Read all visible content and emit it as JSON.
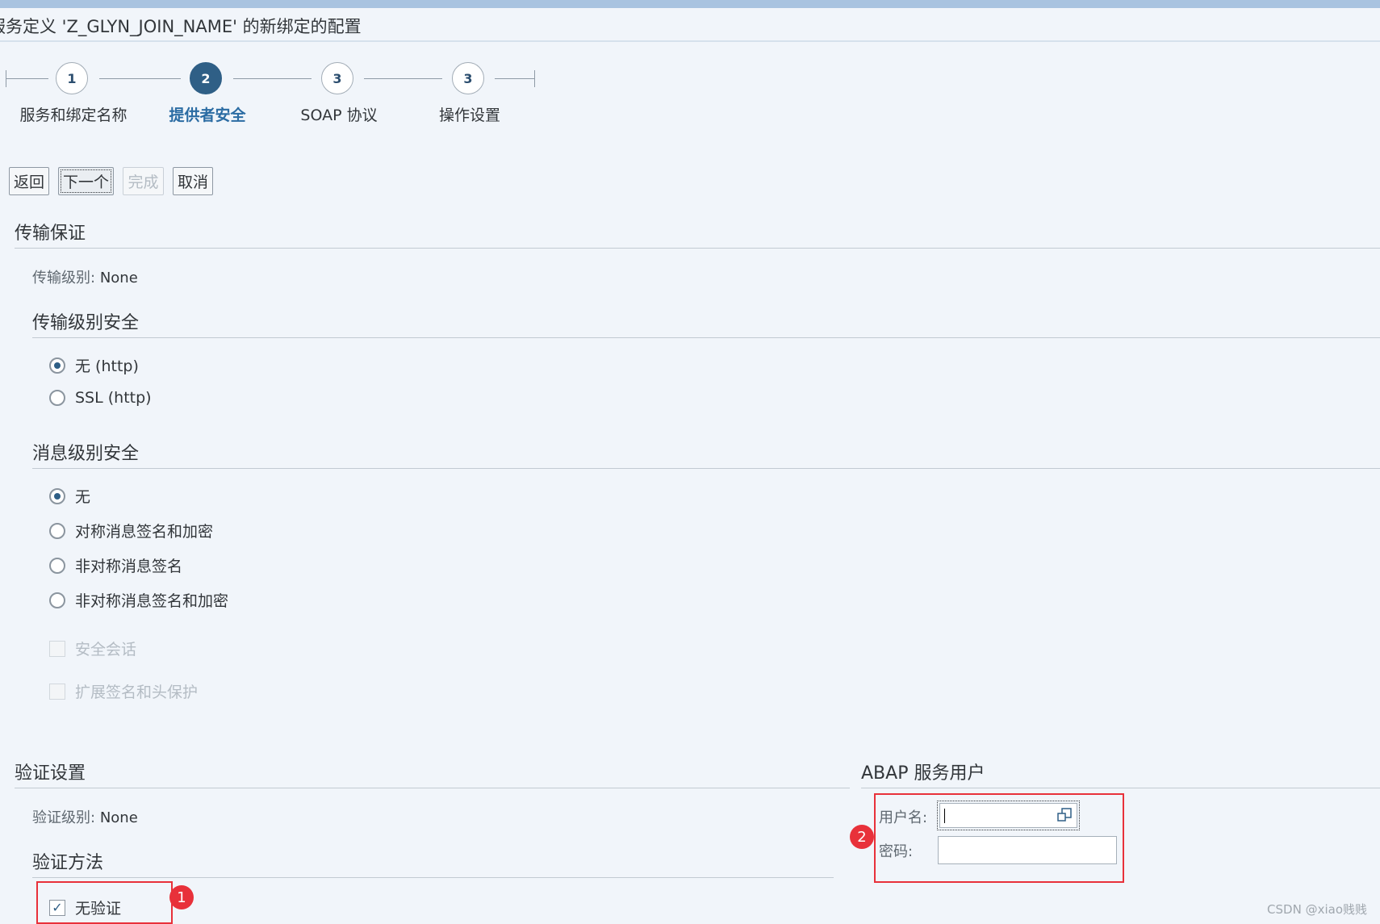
{
  "title": "服务定义 'Z_GLYN_JOIN_NAME' 的新绑定的配置",
  "wizard": {
    "steps": [
      {
        "number": "1",
        "label": "服务和绑定名称"
      },
      {
        "number": "2",
        "label": "提供者安全"
      },
      {
        "number": "3",
        "label": "SOAP 协议"
      },
      {
        "number": "3",
        "label": "操作设置"
      }
    ],
    "active_step": 2
  },
  "buttons": {
    "back": "返回",
    "next": "下一个",
    "finish": "完成",
    "cancel": "取消"
  },
  "transport": {
    "heading": "传输保证",
    "level_label": "传输级别:",
    "level_value": "None",
    "security_heading": "传输级别安全",
    "options": [
      {
        "label": "无 (http)",
        "selected": true
      },
      {
        "label": "SSL (http)",
        "selected": false
      }
    ]
  },
  "message": {
    "heading": "消息级别安全",
    "options": [
      {
        "label": "无",
        "selected": true
      },
      {
        "label": "对称消息签名和加密",
        "selected": false
      },
      {
        "label": "非对称消息签名",
        "selected": false
      },
      {
        "label": "非对称消息签名和加密",
        "selected": false
      }
    ],
    "secure_session": "安全会话",
    "extended_signature": "扩展签名和头保护"
  },
  "auth": {
    "heading": "验证设置",
    "level_label": "验证级别:",
    "level_value": "None",
    "method_heading": "验证方法",
    "no_auth": "无验证",
    "no_auth_checked": true
  },
  "abap_user": {
    "heading": "ABAP 服务用户",
    "username_label": "用户名:",
    "username_value": "",
    "password_label": "密码:",
    "password_value": ""
  },
  "annotations": {
    "marker1": "1",
    "marker2": "2"
  },
  "watermark": "CSDN @xiao贱贱",
  "colors": {
    "accent": "#2f5f86",
    "highlight_red": "#e8313a",
    "background": "#f1f5fa"
  }
}
